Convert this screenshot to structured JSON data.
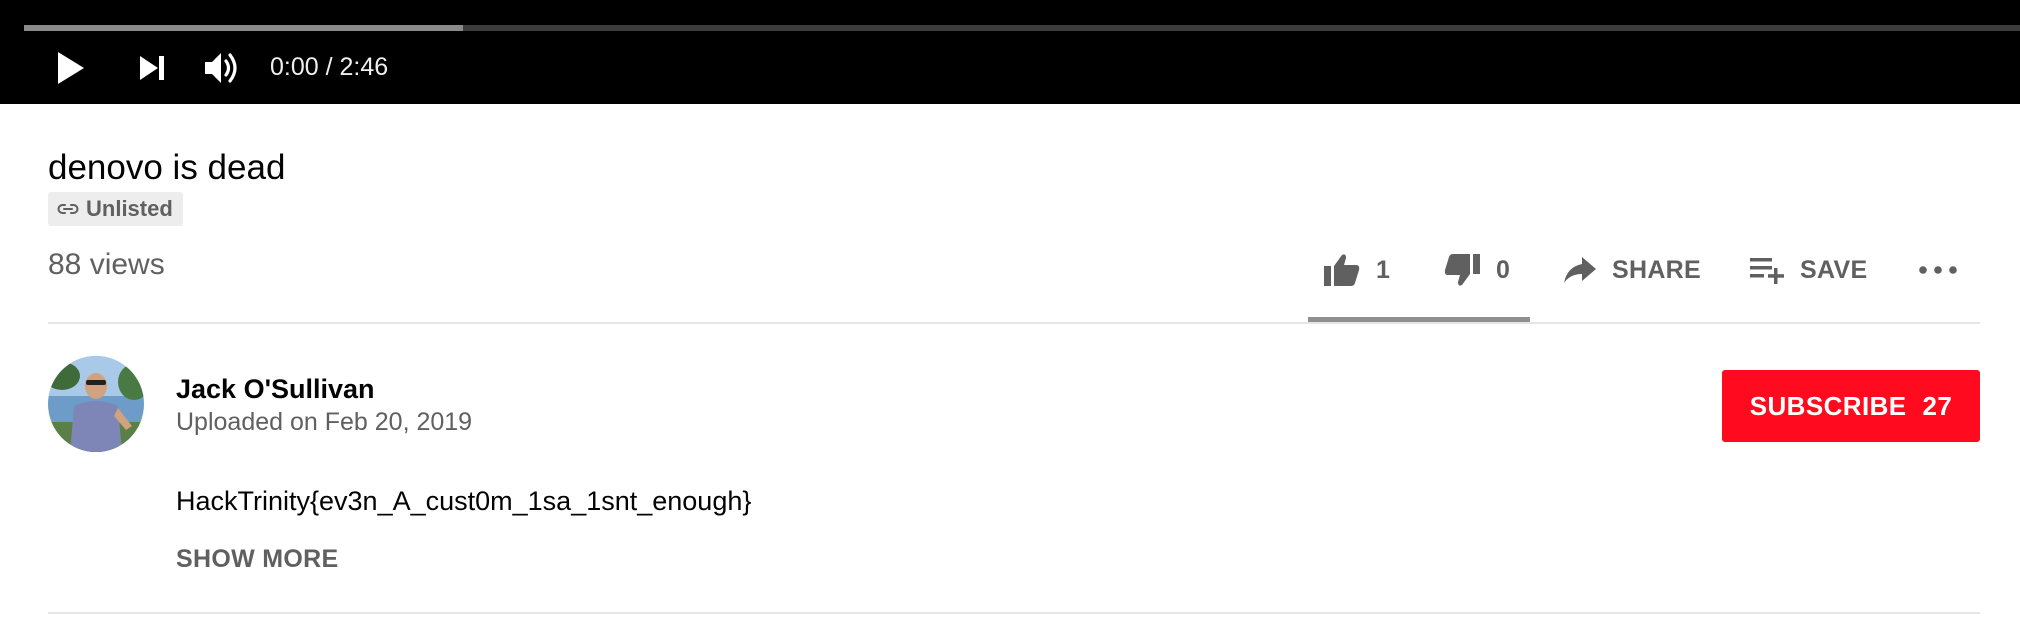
{
  "player": {
    "progress_fraction": 0.22,
    "time_display": "0:00 / 2:46",
    "controls": {
      "play_icon": "play-icon",
      "next_icon": "next-icon",
      "volume_icon": "volume-icon"
    }
  },
  "video": {
    "title": "denovo is dead",
    "privacy_badge": "Unlisted",
    "privacy_icon": "link-icon",
    "views": "88 views"
  },
  "actions": {
    "like_count": "1",
    "dislike_count": "0",
    "share_label": "SHARE",
    "save_label": "SAVE",
    "like_icon": "thumbs-up-icon",
    "dislike_icon": "thumbs-down-icon",
    "share_icon": "share-arrow-icon",
    "save_icon": "playlist-add-icon",
    "more_icon": "more-horizontal-icon"
  },
  "owner": {
    "channel_name": "Jack O'Sullivan",
    "upload_date": "Uploaded on Feb 20, 2019",
    "subscribe_label": "SUBSCRIBE",
    "subscriber_count": "27"
  },
  "description": {
    "text": "HackTrinity{ev3n_A_cust0m_1sa_1snt_enough}",
    "show_more_label": "SHOW MORE"
  },
  "colors": {
    "subscribe_red": "#ff0a1e",
    "player_black": "#000000",
    "secondary_text": "#606060"
  }
}
